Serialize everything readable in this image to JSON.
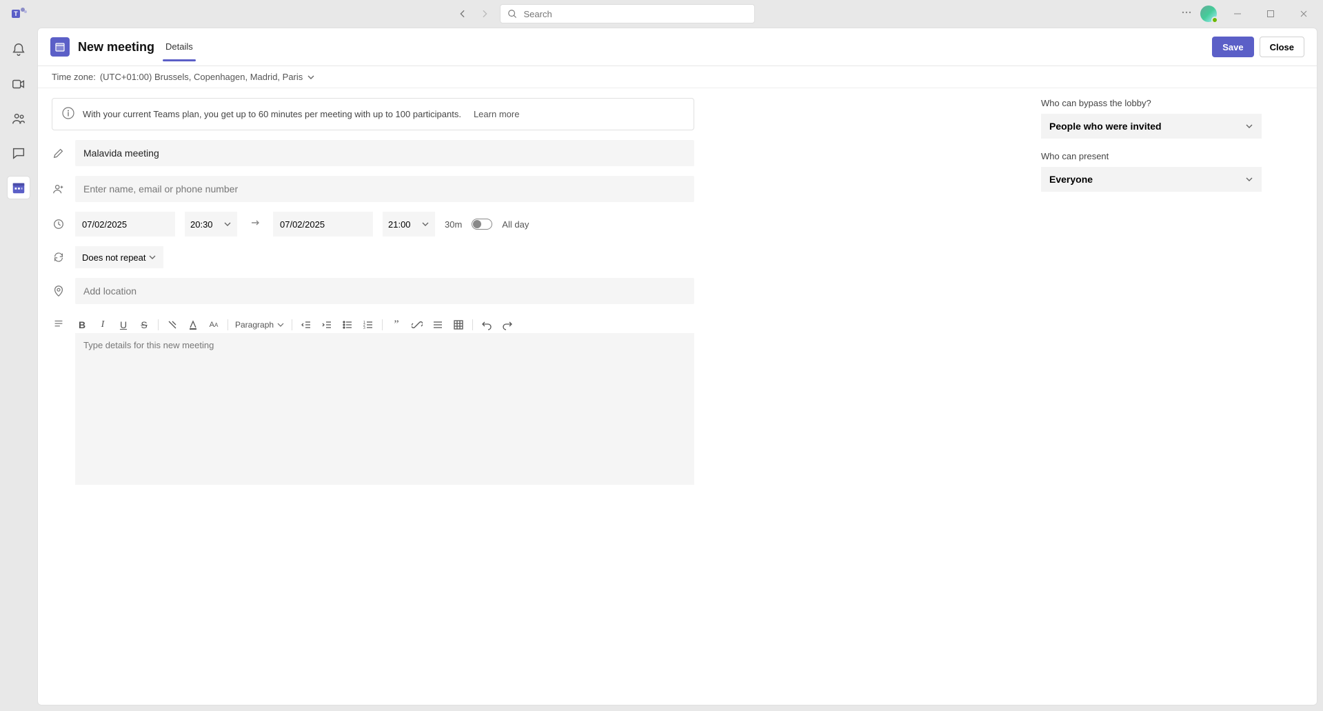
{
  "search": {
    "placeholder": "Search"
  },
  "header": {
    "title": "New meeting",
    "tabs": {
      "details": "Details"
    },
    "save_label": "Save",
    "close_label": "Close"
  },
  "subheader": {
    "prefix": "Time zone:",
    "timezone": "(UTC+01:00) Brussels, Copenhagen, Madrid, Paris"
  },
  "banner": {
    "text": "With your current Teams plan, you get up to 60 minutes per meeting with up to 100 participants.",
    "learn_more": "Learn more"
  },
  "form": {
    "title_value": "Malavida meeting",
    "attendees_placeholder": "Enter name, email or phone number",
    "start_date": "07/02/2025",
    "start_time": "20:30",
    "end_date": "07/02/2025",
    "end_time": "21:00",
    "duration": "30m",
    "allday_label": "All day",
    "repeat_label": "Does not repeat",
    "location_placeholder": "Add location",
    "details_placeholder": "Type details for this new meeting",
    "paragraph_label": "Paragraph"
  },
  "options": {
    "bypass_label": "Who can bypass the lobby?",
    "bypass_value": "People who were invited",
    "present_label": "Who can present",
    "present_value": "Everyone"
  }
}
